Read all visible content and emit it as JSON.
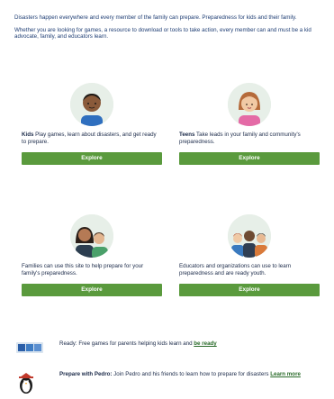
{
  "intro": {
    "paragraph1": "Disasters happen everywhere and every member of the family can prepare. Preparedness for kids and their family.",
    "paragraph2": "Whether you are looking for games, a resource to download or tools to take action, every member can and must be a kid advocate, family, and educators learn."
  },
  "cards": [
    {
      "title": "Kids",
      "text": "Play games, learn about disasters, and get ready to prepare.",
      "button": "Explore"
    },
    {
      "title": "Teens",
      "text": "Take leads in your family and community's preparedness.",
      "button": "Explore"
    },
    {
      "title": "",
      "text": "Families can use this site to help prepare for your family's preparedness.",
      "button": "Explore"
    },
    {
      "title": "",
      "text": "Educators and organizations can use to learn preparedness and are ready youth.",
      "button": "Explore"
    }
  ],
  "footer": {
    "ready_text": "Ready: Free games for parents helping kids learn and ",
    "ready_link": "be ready",
    "pedro_title": "Prepare with Pedro:",
    "pedro_text": " Join Pedro and his friends to learn how to prepare for disasters ",
    "pedro_link": "Learn more"
  },
  "colors": {
    "button_green": "#5a9a3d",
    "avatar_bg": "#e7efe8",
    "heading_blue": "#1f3e74"
  }
}
